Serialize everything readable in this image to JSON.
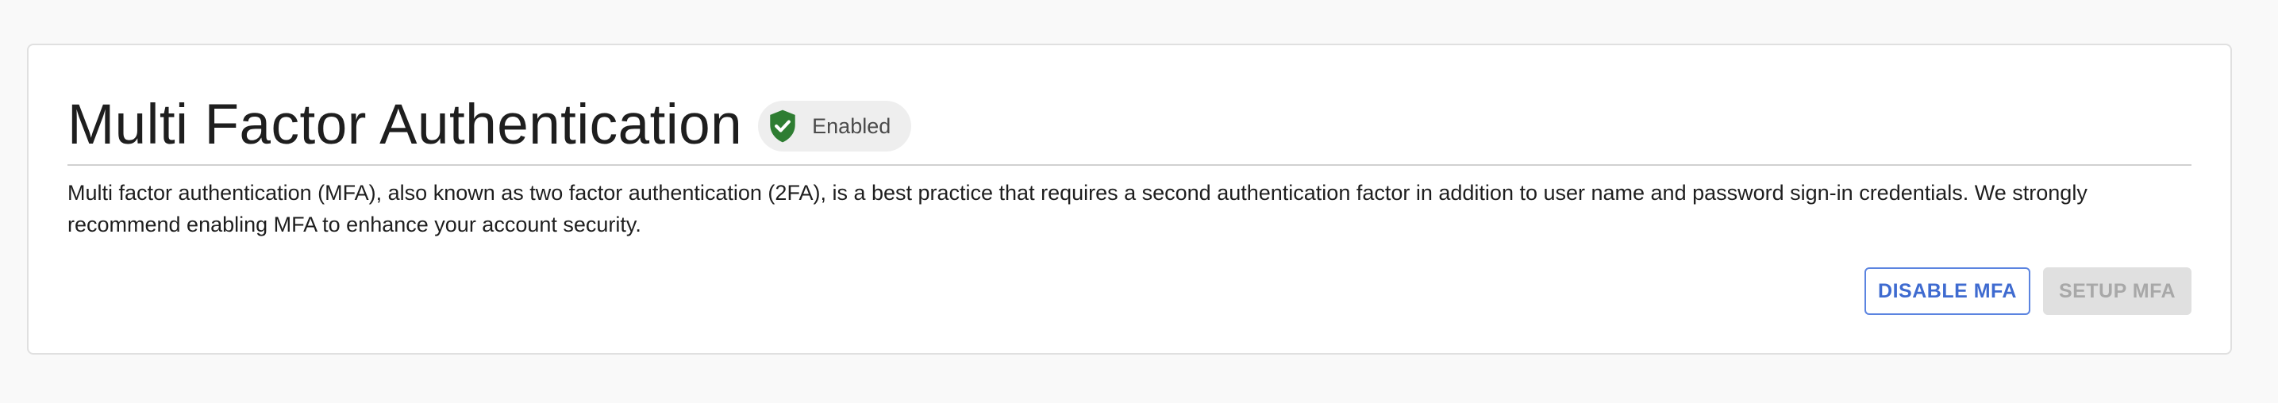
{
  "card": {
    "title": "Multi Factor Authentication",
    "status": {
      "label": "Enabled",
      "icon": "shield-check-icon",
      "icon_color": "#2e7d32"
    },
    "description": "Multi factor authentication (MFA), also known as two factor authentication (2FA), is a best practice that requires a second authentication factor in addition to user name and password sign-in credentials. We strongly recommend enabling MFA to enhance your account security.",
    "actions": {
      "disable_label": "DISABLE MFA",
      "setup_label": "SETUP MFA",
      "setup_disabled": true
    }
  },
  "colors": {
    "accent": "#3f6bd0",
    "success": "#2e7d32",
    "disabled_bg": "#e0e0e0",
    "disabled_text": "#a8a8a8"
  }
}
